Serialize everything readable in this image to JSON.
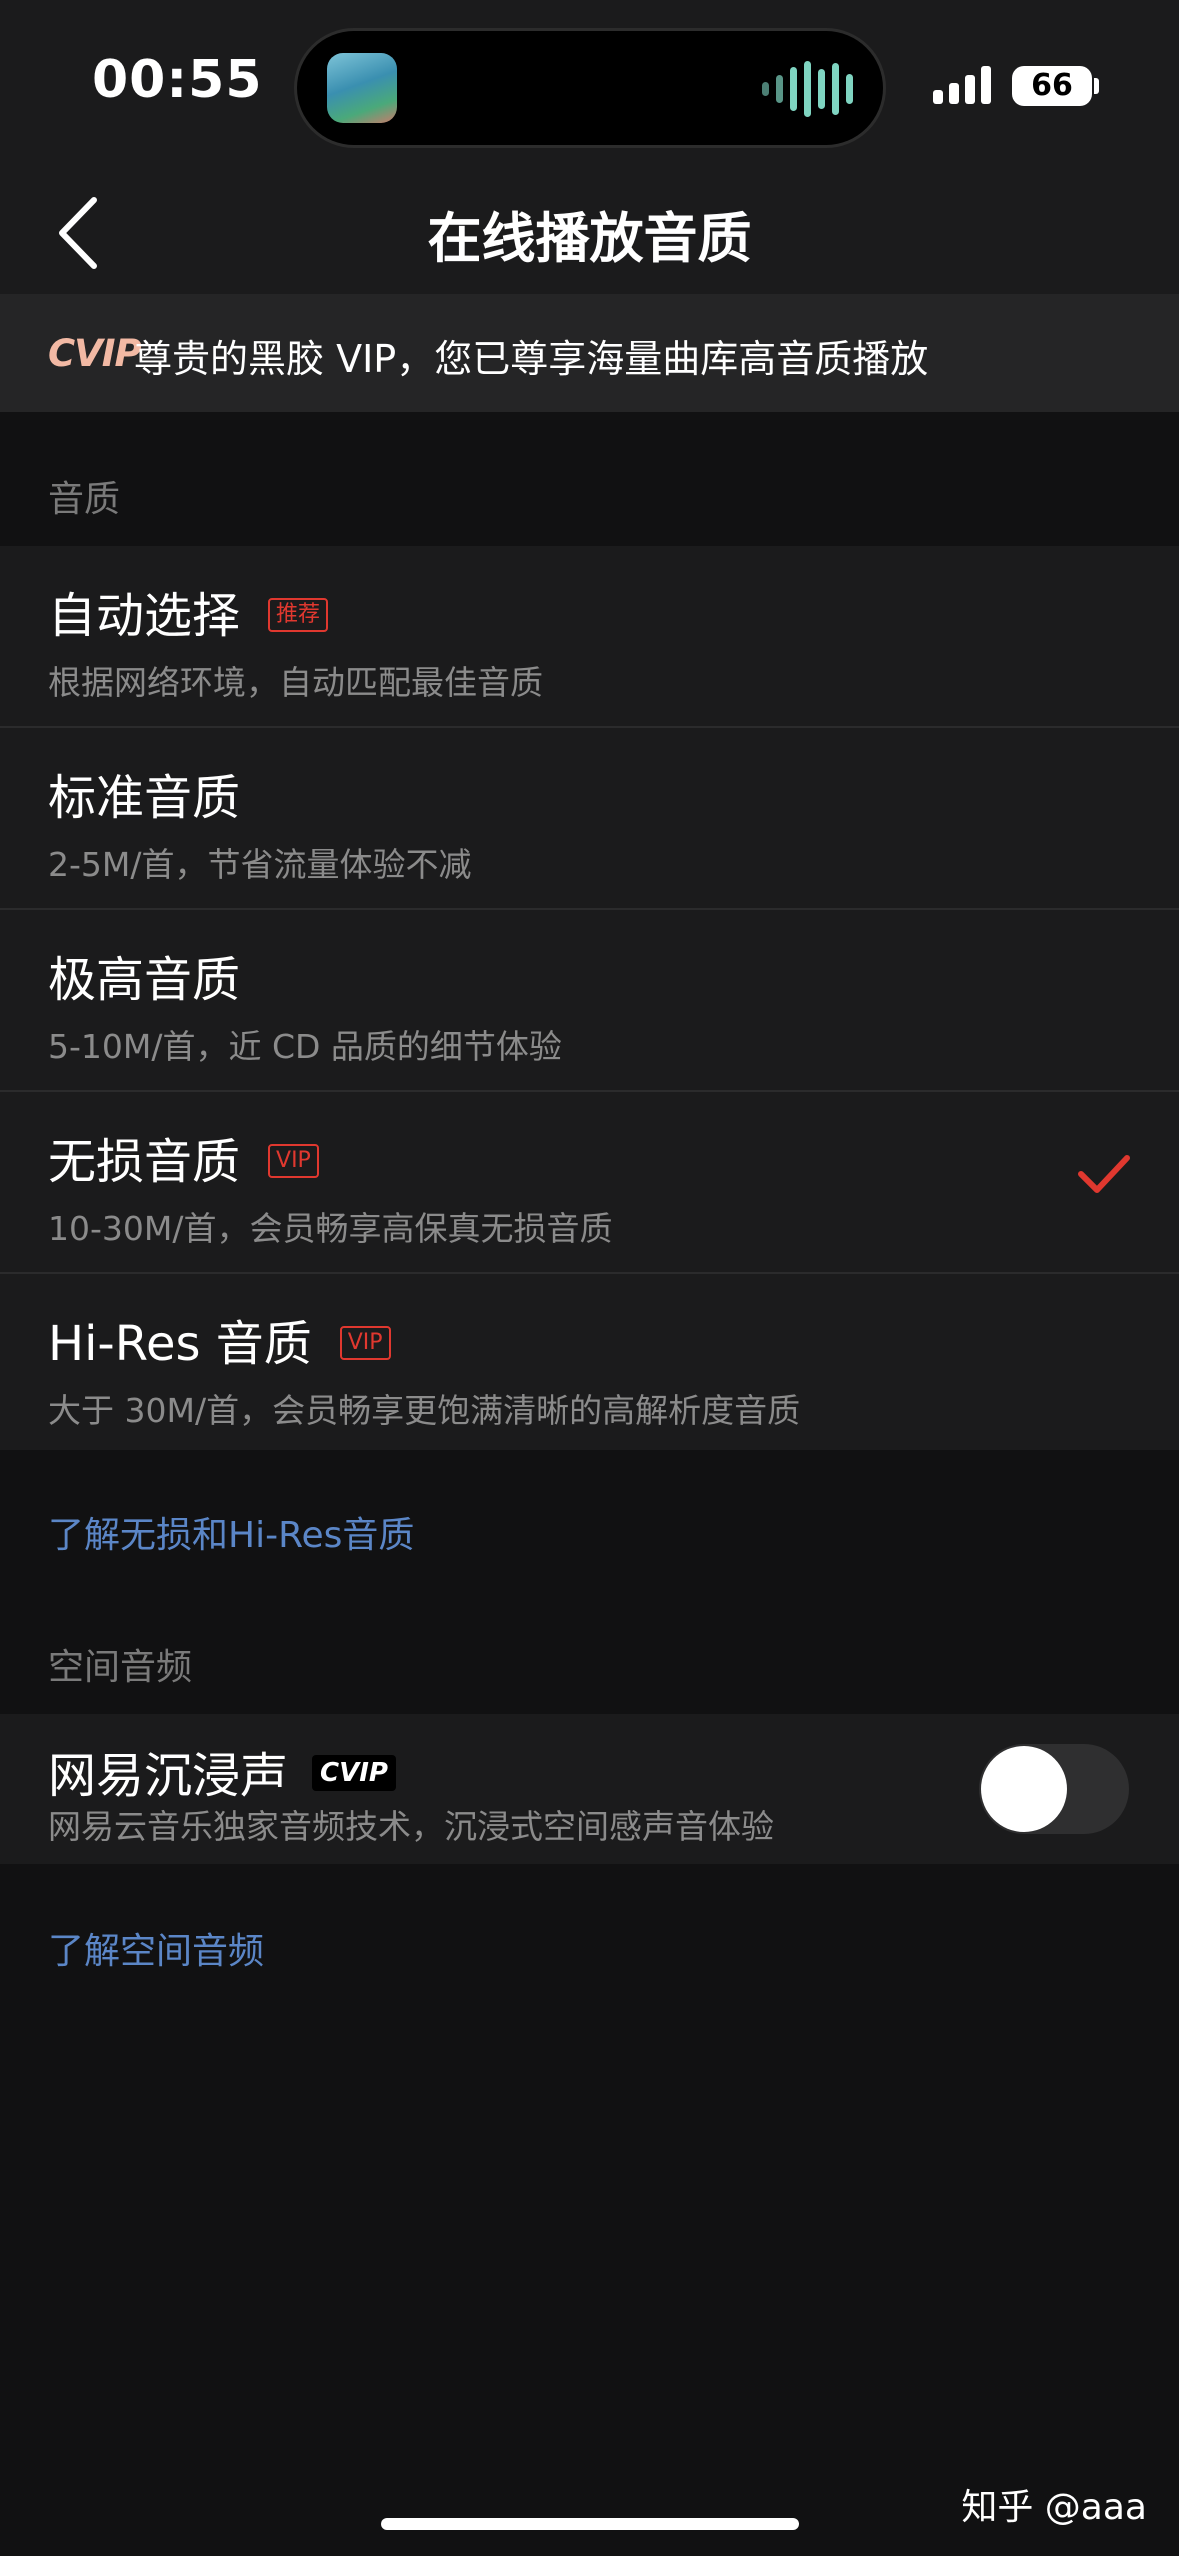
{
  "status_bar": {
    "time": "00:55",
    "battery": "66"
  },
  "nav": {
    "title": "在线播放音质"
  },
  "vip_banner": {
    "logo": "CVIP",
    "text": "尊贵的黑胶 VIP，您已尊享海量曲库高音质播放"
  },
  "quality_section": {
    "label": "音质",
    "selected_index": 3,
    "options": [
      {
        "title": "自动选择",
        "badge": "推荐",
        "desc": "根据网络环境，自动匹配最佳音质"
      },
      {
        "title": "标准音质",
        "badge": "",
        "desc": "2-5M/首，节省流量体验不减"
      },
      {
        "title": "极高音质",
        "badge": "",
        "desc": "5-10M/首，近 CD 品质的细节体验"
      },
      {
        "title": "无损音质",
        "badge": "VIP",
        "desc": "10-30M/首，会员畅享高保真无损音质"
      },
      {
        "title": "Hi-Res 音质",
        "badge": "VIP",
        "desc": "大于 30M/首，会员畅享更饱满清晰的高解析度音质"
      }
    ],
    "link": "了解无损和Hi-Res音质"
  },
  "spatial_section": {
    "label": "空间音频",
    "item": {
      "title": "网易沉浸声",
      "badge": "CVIP",
      "desc": "网易云音乐独家音频技术，沉浸式空间感声音体验",
      "enabled": false
    },
    "link": "了解空间音频"
  },
  "watermark": "知乎 @aaa",
  "colors": {
    "accent_red": "#e0382f",
    "link_blue": "#5b86c7",
    "background": "#111112",
    "card": "#1b1b1c"
  },
  "icons": {
    "back": "chevron-left-icon",
    "check": "check-icon"
  }
}
